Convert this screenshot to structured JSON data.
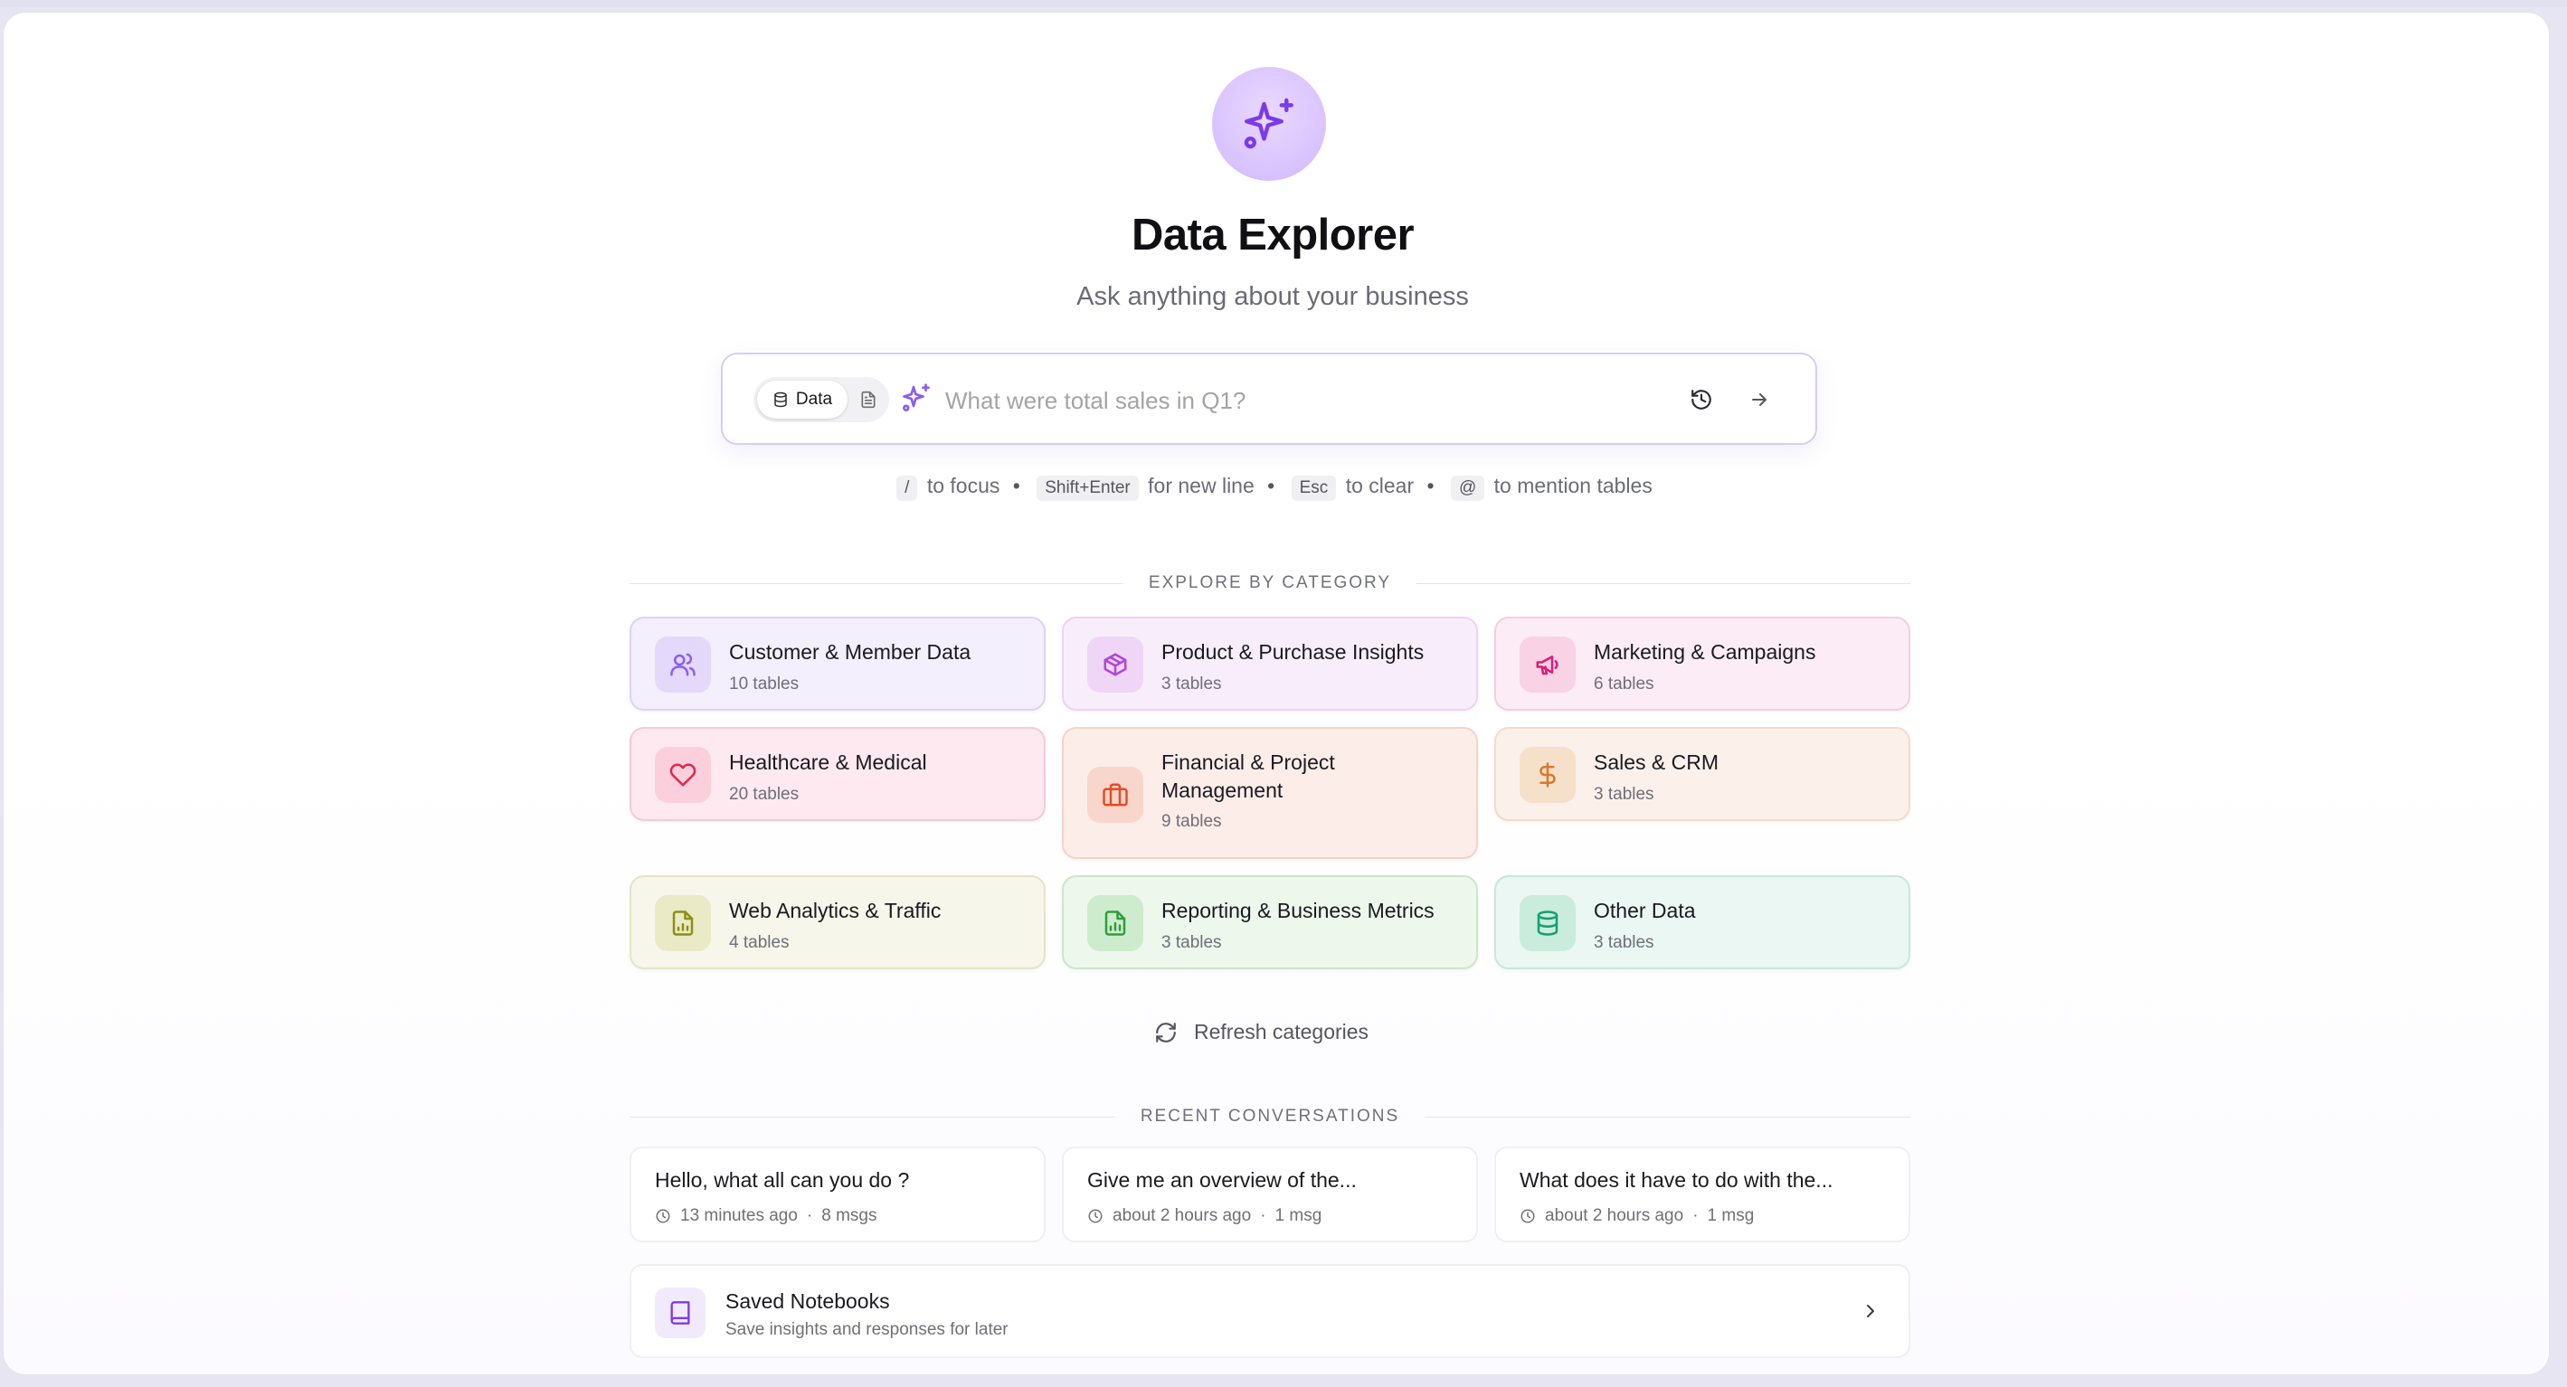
{
  "header": {
    "title": "Data Explorer",
    "subtitle": "Ask anything about your business"
  },
  "search": {
    "mode_data_label": "Data",
    "placeholder": "What were total sales in Q1?"
  },
  "hints": {
    "focus_key": "/",
    "focus_text": "to focus",
    "newline_key": "Shift+Enter",
    "newline_text": "for new line",
    "clear_key": "Esc",
    "clear_text": "to clear",
    "mention_key": "@",
    "mention_text": "to mention tables",
    "separator": "•"
  },
  "categories_section": {
    "heading": "EXPLORE BY CATEGORY",
    "items": [
      {
        "name": "Customer & Member Data",
        "count": "10 tables",
        "icon": "users-icon",
        "bg": "#f3effd",
        "border": "#ded2fa",
        "icon_bg": "#e4d8fb",
        "icon_color": "#8a5cf0"
      },
      {
        "name": "Product & Purchase Insights",
        "count": "3 tables",
        "icon": "package-icon",
        "bg": "#f8eefb",
        "border": "#ecd3f5",
        "icon_bg": "#efd6f7",
        "icon_color": "#b046d8"
      },
      {
        "name": "Marketing & Campaigns",
        "count": "6 tables",
        "icon": "megaphone-icon",
        "bg": "#fcecf5",
        "border": "#f6cde3",
        "icon_bg": "#f9d2e6",
        "icon_color": "#d81e78"
      },
      {
        "name": "Healthcare & Medical",
        "count": "20 tables",
        "icon": "heart-icon",
        "bg": "#fde9ef",
        "border": "#f8c9d6",
        "icon_bg": "#fbd0dc",
        "icon_color": "#e2264a"
      },
      {
        "name": "Financial & Project Management",
        "count": "9 tables",
        "icon": "briefcase-icon",
        "bg": "#fcede9",
        "border": "#f6d2c8",
        "icon_bg": "#f9d6cb",
        "icon_color": "#e84a25"
      },
      {
        "name": "Sales & CRM",
        "count": "3 tables",
        "icon": "dollar-icon",
        "bg": "#fbf1ea",
        "border": "#f1dccb",
        "icon_bg": "#f5e0ca",
        "icon_color": "#d9782a"
      },
      {
        "name": "Web Analytics & Traffic",
        "count": "4 tables",
        "icon": "file-chart-icon",
        "bg": "#f6f6ea",
        "border": "#e4e5c6",
        "icon_bg": "#eaeac6",
        "icon_color": "#8a9014"
      },
      {
        "name": "Reporting & Business Metrics",
        "count": "3 tables",
        "icon": "file-spreadsheet-icon",
        "bg": "#edf7ec",
        "border": "#c9e8c9",
        "icon_bg": "#cdeccd",
        "icon_color": "#2e9e3a"
      },
      {
        "name": "Other Data",
        "count": "3 tables",
        "icon": "database-icon",
        "bg": "#ebf7f2",
        "border": "#c6e8da",
        "icon_bg": "#c9ecdd",
        "icon_color": "#12a070"
      }
    ],
    "refresh_label": "Refresh categories"
  },
  "recent_section": {
    "heading": "RECENT CONVERSATIONS",
    "items": [
      {
        "title": "Hello, what all can you do ?",
        "time": "13 minutes ago",
        "msgs": "8 msgs"
      },
      {
        "title": "Give me an overview of the...",
        "time": "about 2 hours ago",
        "msgs": "1 msg"
      },
      {
        "title": "What does it have to do with the...",
        "time": "about 2 hours ago",
        "msgs": "1 msg"
      }
    ],
    "meta_separator": "·"
  },
  "notebooks": {
    "title": "Saved Notebooks",
    "subtitle": "Save insights and responses for later"
  }
}
